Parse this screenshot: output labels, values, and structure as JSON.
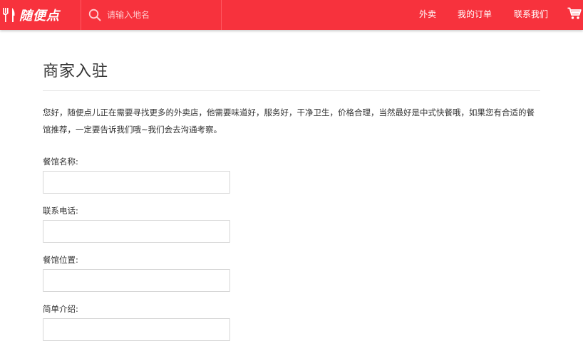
{
  "header": {
    "brand_name": "随便点",
    "brand_icon": "fork-knife-icon",
    "search": {
      "placeholder": "请输入地名",
      "value": "",
      "icon": "search-icon"
    },
    "nav": [
      {
        "label": "外卖"
      },
      {
        "label": "我的订单"
      },
      {
        "label": "联系我们"
      }
    ],
    "cart_icon": "shopping-cart-icon",
    "accent_color": "#f7323d"
  },
  "main": {
    "title": "商家入驻",
    "intro": "您好，随便点儿正在需要寻找更多的外卖店，他需要味道好，服务好，干净卫生，价格合理，当然最好是中式快餐哦，如果您有合适的餐馆推荐，一定要告诉我们哦~我们会去沟通考察。",
    "fields": [
      {
        "label": "餐馆名称:",
        "value": ""
      },
      {
        "label": "联系电话:",
        "value": ""
      },
      {
        "label": "餐馆位置:",
        "value": ""
      },
      {
        "label": "简单介绍:",
        "value": ""
      }
    ]
  }
}
